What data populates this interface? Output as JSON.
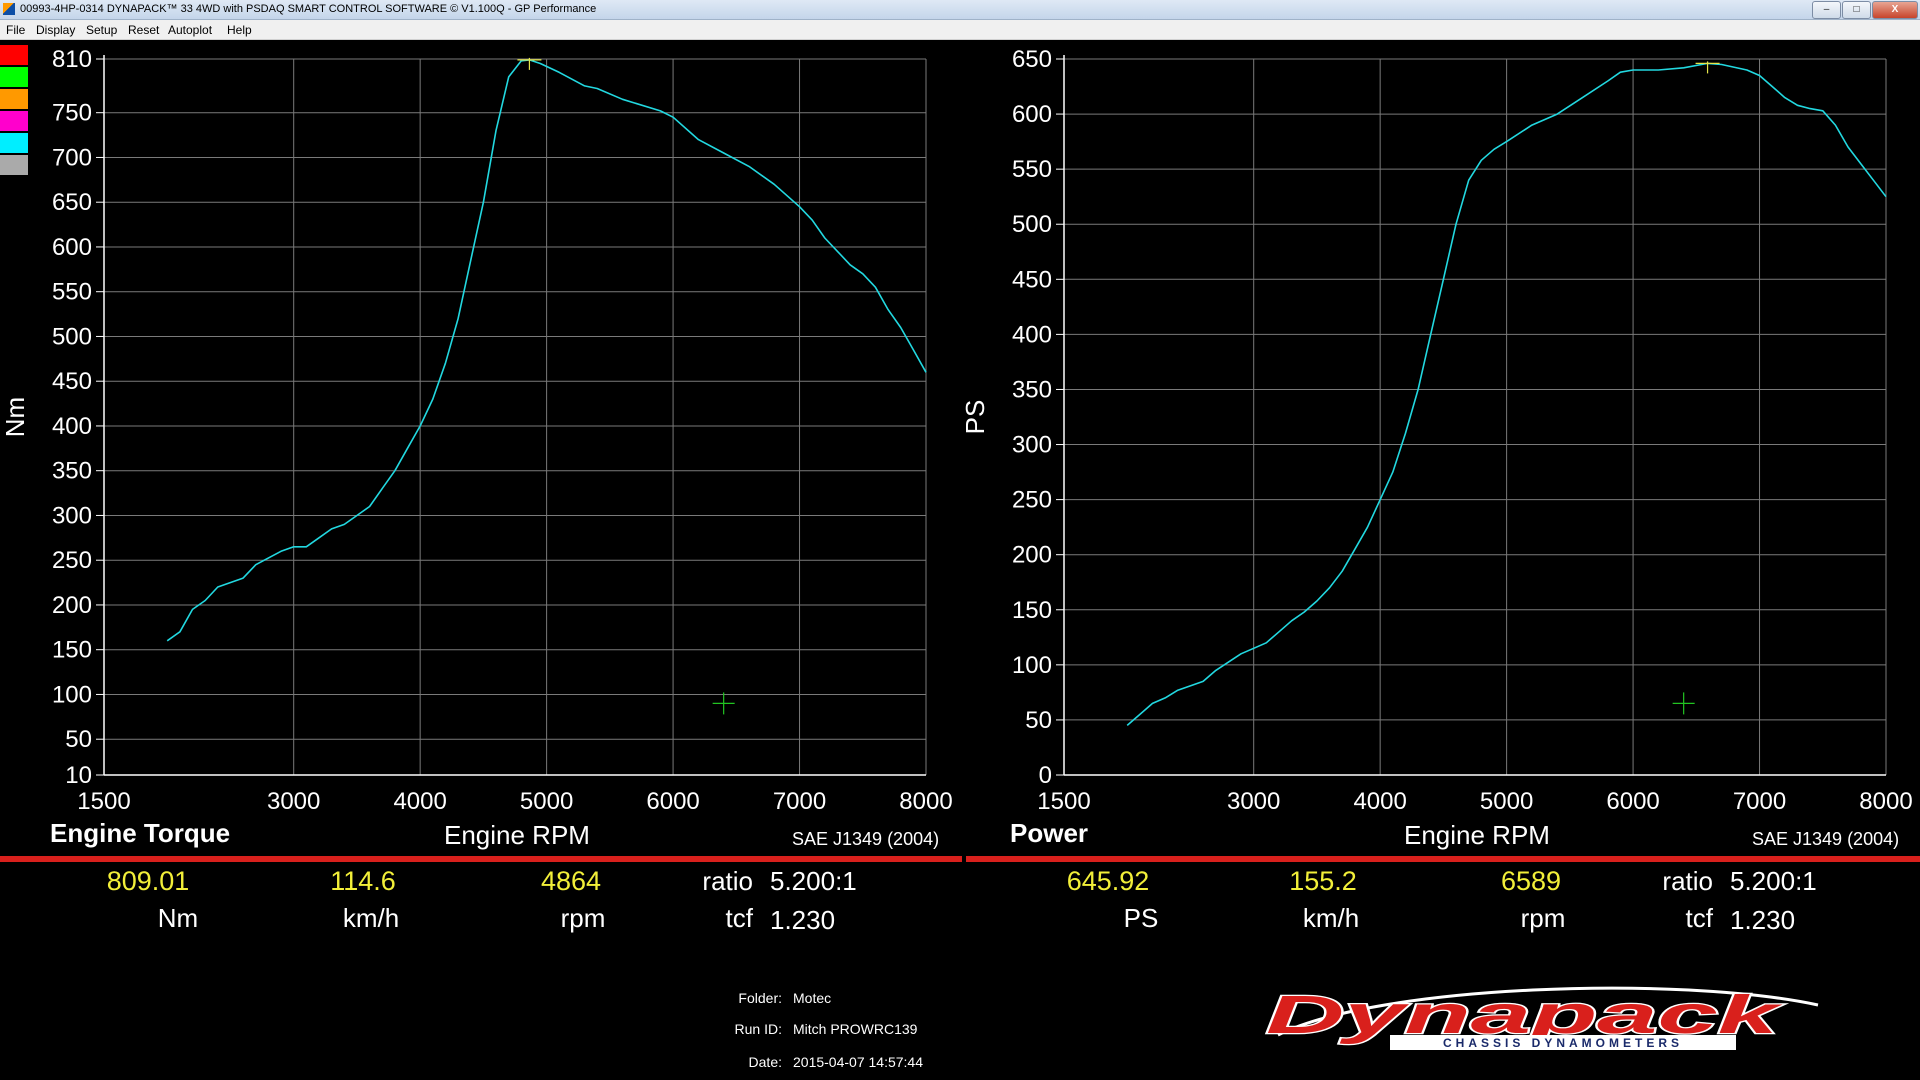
{
  "window": {
    "title": "00993-4HP-0314 DYNAPACK™ 33 4WD with PSDAQ SMART CONTROL SOFTWARE © V1.100Q - GP Performance",
    "controls": [
      "–",
      "□",
      "X"
    ]
  },
  "menu": [
    "File",
    "Display",
    "Setup",
    "Reset",
    "Autoplot",
    "Help"
  ],
  "colors": {
    "curve": "#22d8e0",
    "grid": "#7a7a7a",
    "marker_peak": "#e5e54a",
    "marker_cursor": "#22c422",
    "red_bar": "#d9201c",
    "value_yellow": "#f2ef39",
    "swatches": [
      "#ff0000",
      "#00ff00",
      "#ff9900",
      "#ff00cc",
      "#00eeff",
      "#aaaaaa"
    ]
  },
  "chart_data": [
    {
      "type": "line",
      "title": "Engine Torque",
      "xlabel": "Engine RPM",
      "ylabel": "Nm",
      "xlim": [
        1500,
        8000
      ],
      "ylim": [
        10,
        810
      ],
      "xticks": [
        1500,
        3000,
        4000,
        5000,
        6000,
        7000,
        8000
      ],
      "yticks": [
        10,
        50,
        100,
        150,
        200,
        250,
        300,
        350,
        400,
        450,
        500,
        550,
        600,
        650,
        700,
        750,
        810
      ],
      "grid": true,
      "series": [
        {
          "x": [
            2000,
            2100,
            2200,
            2300,
            2400,
            2600,
            2700,
            2900,
            3000,
            3100,
            3200,
            3300,
            3400,
            3500,
            3600,
            3700,
            3800,
            3900,
            4000,
            4100,
            4200,
            4300,
            4400,
            4500,
            4600,
            4700,
            4800,
            4864,
            4950,
            5100,
            5300,
            5400,
            5600,
            5900,
            6000,
            6200,
            6400,
            6600,
            6800,
            7000,
            7100,
            7200,
            7300,
            7400,
            7500,
            7600,
            7700,
            7800,
            7900,
            8000
          ],
          "values": [
            160,
            170,
            195,
            205,
            220,
            230,
            245,
            260,
            265,
            265,
            275,
            285,
            290,
            300,
            310,
            330,
            350,
            375,
            400,
            430,
            470,
            520,
            585,
            650,
            730,
            790,
            808,
            809,
            805,
            795,
            780,
            777,
            765,
            752,
            745,
            720,
            705,
            690,
            670,
            645,
            630,
            610,
            595,
            580,
            570,
            555,
            530,
            510,
            485,
            460
          ]
        }
      ],
      "peak": {
        "x": 4864,
        "y": 809
      },
      "cursor": {
        "x": 6400,
        "y": 90
      }
    },
    {
      "type": "line",
      "title": "Power",
      "xlabel": "Engine RPM",
      "ylabel": "PS",
      "xlim": [
        1500,
        8000
      ],
      "ylim": [
        0,
        650
      ],
      "xticks": [
        1500,
        3000,
        4000,
        5000,
        6000,
        7000,
        8000
      ],
      "yticks": [
        0,
        50,
        100,
        150,
        200,
        250,
        300,
        350,
        400,
        450,
        500,
        550,
        600,
        650
      ],
      "grid": true,
      "series": [
        {
          "x": [
            2000,
            2100,
            2200,
            2300,
            2400,
            2600,
            2700,
            2900,
            3000,
            3100,
            3200,
            3300,
            3400,
            3500,
            3600,
            3700,
            3800,
            3900,
            4000,
            4100,
            4200,
            4300,
            4400,
            4500,
            4600,
            4700,
            4800,
            4900,
            5000,
            5200,
            5400,
            5600,
            5800,
            5900,
            6000,
            6200,
            6400,
            6589,
            6700,
            6900,
            7000,
            7100,
            7200,
            7300,
            7400,
            7500,
            7600,
            7700,
            7800,
            7900,
            8000
          ],
          "values": [
            45,
            55,
            65,
            70,
            77,
            85,
            95,
            110,
            115,
            120,
            130,
            140,
            148,
            158,
            170,
            185,
            205,
            225,
            250,
            275,
            310,
            350,
            400,
            450,
            500,
            540,
            558,
            568,
            575,
            590,
            600,
            615,
            630,
            638,
            640,
            640,
            642,
            646,
            645,
            640,
            635,
            625,
            615,
            608,
            605,
            603,
            590,
            570,
            555,
            540,
            525
          ]
        }
      ],
      "peak": {
        "x": 6589,
        "y": 646
      },
      "cursor": {
        "x": 6400,
        "y": 65
      }
    }
  ],
  "left": {
    "header": "Engine Torque",
    "xlabel": "Engine RPM",
    "sae": "SAE J1349 (2004)",
    "values": [
      {
        "value": "809.01",
        "unit": "Nm"
      },
      {
        "value": "114.6",
        "unit": "km/h"
      },
      {
        "value": "4864",
        "unit": "rpm"
      }
    ],
    "ratio_label": "ratio",
    "ratio_value": "5.200:1",
    "tcf_label": "tcf",
    "tcf_value": "1.230"
  },
  "right": {
    "header": "Power",
    "xlabel": "Engine RPM",
    "sae": "SAE J1349 (2004)",
    "values": [
      {
        "value": "645.92",
        "unit": "PS"
      },
      {
        "value": "155.2",
        "unit": "km/h"
      },
      {
        "value": "6589",
        "unit": "rpm"
      }
    ],
    "ratio_label": "ratio",
    "ratio_value": "5.200:1",
    "tcf_label": "tcf",
    "tcf_value": "1.230"
  },
  "meta": {
    "folder_label": "Folder:",
    "folder": "Motec",
    "runid_label": "Run ID:",
    "runid": "Mitch PROWRC139",
    "date_label": "Date:",
    "date": "2015-04-07 14:57:44"
  },
  "logo": {
    "name": "Dynapack",
    "tagline": "CHASSIS DYNAMOMETERS"
  }
}
